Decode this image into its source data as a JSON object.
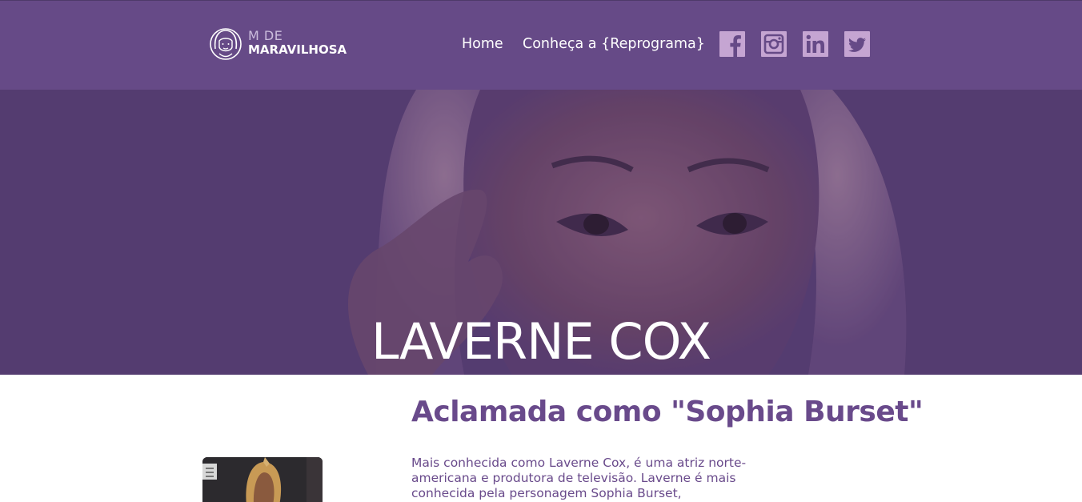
{
  "brand": {
    "logo_top": "M DE",
    "logo_bottom": "MARAVILHOSA"
  },
  "nav": {
    "items": [
      {
        "label": "Home"
      },
      {
        "label": "Conheça a {Reprograma}"
      }
    ]
  },
  "social": [
    {
      "icon": "facebook-icon"
    },
    {
      "icon": "instagram-icon"
    },
    {
      "icon": "linkedin-icon"
    },
    {
      "icon": "twitter-icon"
    }
  ],
  "hero": {
    "title": "LAVERNE COX"
  },
  "content": {
    "title": "Aclamada como \"Sophia Burset\"",
    "text": "Mais conhecida como Laverne Cox, é uma atriz norte-americana e produtora de televisão. Laverne é mais conhecida pela personagem Sophia Burset,"
  },
  "colors": {
    "header_bg": "#664a87",
    "accent": "#694a8b",
    "social_icon": "#c5a5d2"
  }
}
